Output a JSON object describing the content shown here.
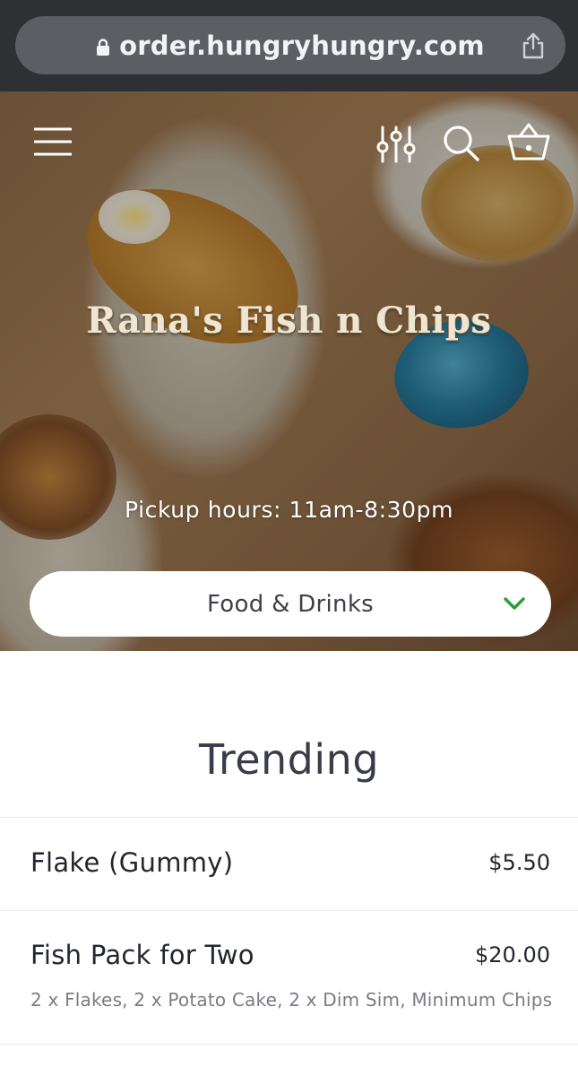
{
  "browser": {
    "url": "order.hungryhungry.com",
    "icons": [
      "lock-icon",
      "share-icon"
    ]
  },
  "hero": {
    "restaurant_name": "Rana's Fish n Chips",
    "pickup_hours": "Pickup hours: 11am-8:30pm",
    "icons": [
      "menu-icon",
      "filter-icon",
      "search-icon",
      "basket-icon"
    ],
    "category_select": {
      "selected": "Food & Drinks",
      "icon": "chevron-down-icon"
    }
  },
  "menu": {
    "section_title": "Trending",
    "items": [
      {
        "name": "Flake (Gummy)",
        "price": "$5.50",
        "description": ""
      },
      {
        "name": "Fish Pack for Two",
        "price": "$20.00",
        "description": "2 x Flakes, 2 x Potato Cake, 2 x Dim Sim, Minimum Chips"
      }
    ]
  },
  "colors": {
    "browser_bar": "#2f3034",
    "url_pill": "#5b5e63",
    "accent_green": "#2e9a3a",
    "text_dark": "#232530",
    "text_muted": "#7a7b86"
  }
}
